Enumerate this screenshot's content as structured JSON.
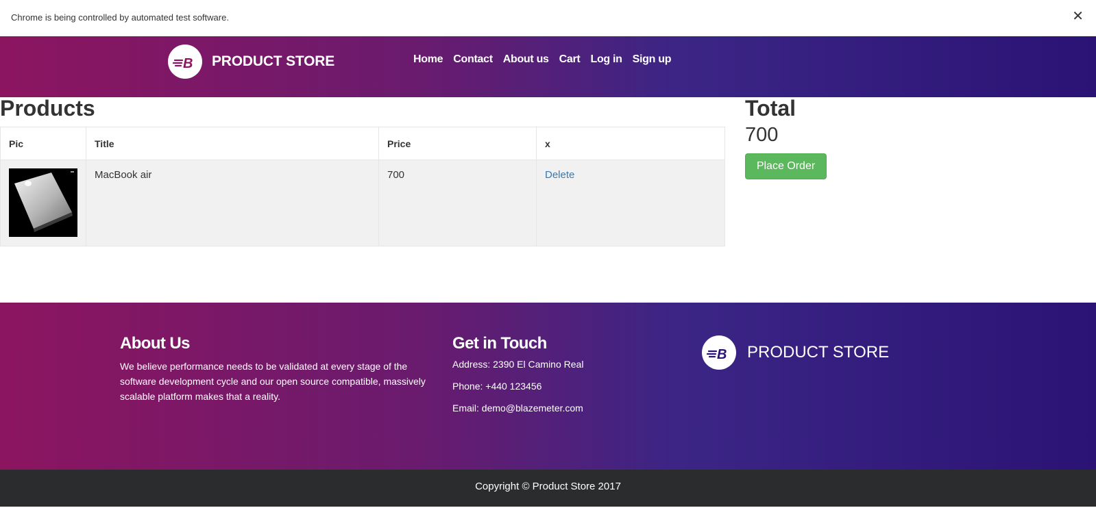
{
  "infobar": {
    "message": "Chrome is being controlled by automated test software.",
    "close_glyph": "✕"
  },
  "navbar": {
    "brand": "PRODUCT STORE",
    "logo_icon": "blazemeter-logo-icon",
    "links": [
      "Home",
      "Contact",
      "About us",
      "Cart",
      "Log in",
      "Sign up"
    ]
  },
  "cart": {
    "title": "Products",
    "columns": [
      "Pic",
      "Title",
      "Price",
      "x"
    ],
    "rows": [
      {
        "title": "MacBook air",
        "price": "700",
        "action": "Delete",
        "pic_icon": "laptop-image"
      }
    ]
  },
  "summary": {
    "total_label": "Total",
    "total_value": "700",
    "place_order_label": "Place Order"
  },
  "footer": {
    "about_heading": "About Us",
    "about_text": "We believe performance needs to be validated at every stage of the software development cycle and our open source compatible, massively scalable platform makes that a reality.",
    "contact_heading": "Get in Touch",
    "address": "Address: 2390 El Camino Real",
    "phone": "Phone: +440 123456",
    "email": "Email: demo@blazemeter.com",
    "brand": "PRODUCT STORE",
    "copyright": "Copyright © Product Store 2017"
  },
  "colors": {
    "gradient_start": "#8c1560",
    "gradient_end": "#2a1374",
    "place_order_green": "#5cb85c",
    "link_blue": "#337ab7",
    "copyright_bg": "#2b2c2e"
  }
}
